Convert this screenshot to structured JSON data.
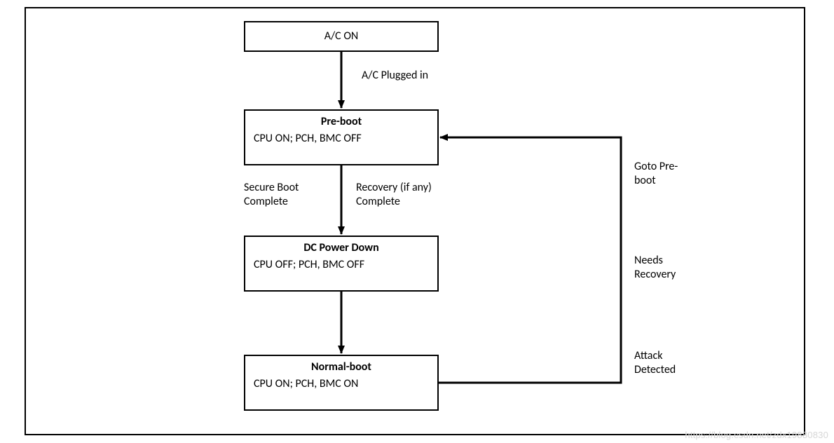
{
  "diagram": {
    "nodes": {
      "ac_on": {
        "title": "A/C ON"
      },
      "pre_boot": {
        "title": "Pre-boot",
        "body": "CPU ON;\nPCH, BMC OFF"
      },
      "dc_power_down": {
        "title": "DC Power Down",
        "body": "CPU OFF;\nPCH, BMC OFF"
      },
      "normal_boot": {
        "title": "Normal-boot",
        "body": "CPU ON;\nPCH, BMC ON"
      }
    },
    "edges": {
      "ac_to_preboot": {
        "label": "A/C Plugged in"
      },
      "preboot_to_dcpd_left": {
        "label": "Secure Boot\nComplete"
      },
      "preboot_to_dcpd_right": {
        "label": "Recovery (if any)\nComplete"
      },
      "dcpd_to_normal": {
        "label": ""
      },
      "normal_to_preboot_top": {
        "label": "Goto Pre-\nboot"
      },
      "normal_to_preboot_mid": {
        "label": "Needs\nRecovery"
      },
      "normal_to_preboot_bot": {
        "label": "Attack\nDetected"
      }
    }
  },
  "watermark": "https://blog.csdn.net/zdx19880830"
}
